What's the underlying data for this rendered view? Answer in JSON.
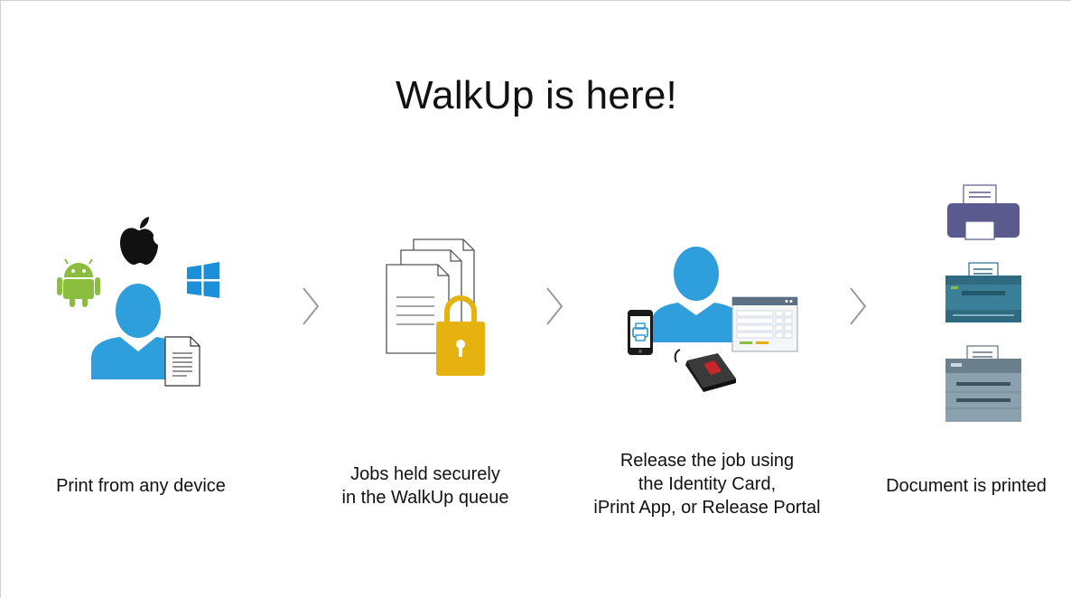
{
  "title": "WalkUp is here!",
  "steps": [
    {
      "lines": [
        "Print from any device"
      ]
    },
    {
      "lines": [
        "Jobs held securely",
        "in the WalkUp queue"
      ]
    },
    {
      "lines": [
        "Release the job using",
        "the Identity Card,",
        "iPrint App, or Release Portal"
      ]
    },
    {
      "lines": [
        "Document is printed"
      ]
    }
  ],
  "colors": {
    "person_blue": "#2e9fdc",
    "lock_gold": "#e5b20f",
    "android_green": "#8bbe3e",
    "windows_blue": "#1c8fd8",
    "printer_purple": "#5a5a8f",
    "printer_teal": "#3a7f97",
    "printer_gray": "#8ba2ae",
    "chevron_gray": "#9a9a9a"
  },
  "icons": {
    "step1": [
      "android-icon",
      "apple-icon",
      "windows-icon",
      "person-icon",
      "document-icon"
    ],
    "step2": [
      "document-stack-icon",
      "padlock-icon"
    ],
    "step3": [
      "smartphone-icon",
      "person-icon",
      "release-portal-icon",
      "card-reader-icon"
    ],
    "step4": [
      "desktop-printer-icon",
      "office-printer-icon",
      "multifunction-printer-icon"
    ],
    "separator": "chevron-right-icon"
  }
}
